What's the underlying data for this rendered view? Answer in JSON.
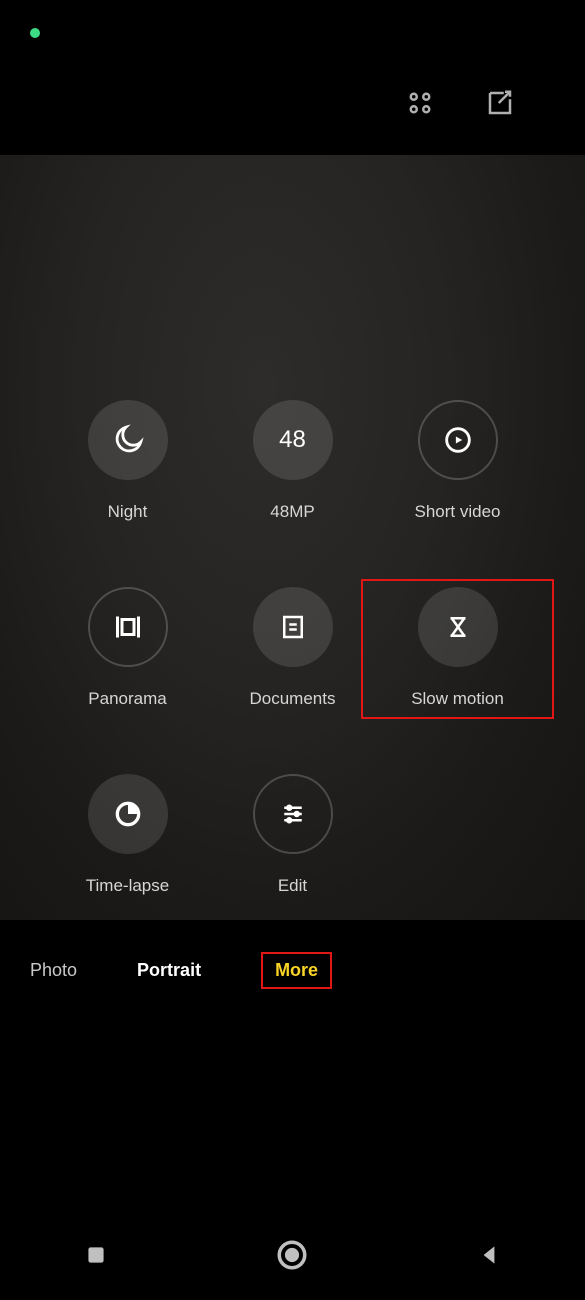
{
  "status": {
    "privacy_indicator": "camera-active"
  },
  "topbar": {
    "grid_icon": "grid-menu",
    "edit_icon": "compose"
  },
  "modes": [
    {
      "id": "night",
      "label": "Night",
      "style": "filled",
      "icon": "moon"
    },
    {
      "id": "48mp",
      "label": "48MP",
      "style": "filled",
      "icon": "text-48",
      "text": "48"
    },
    {
      "id": "short-video",
      "label": "Short video",
      "style": "outlined",
      "icon": "play-circle"
    },
    {
      "id": "panorama",
      "label": "Panorama",
      "style": "outlined",
      "icon": "panorama"
    },
    {
      "id": "documents",
      "label": "Documents",
      "style": "filled",
      "icon": "document"
    },
    {
      "id": "slow-motion",
      "label": "Slow motion",
      "style": "filled",
      "icon": "hourglass",
      "selected": true
    },
    {
      "id": "time-lapse",
      "label": "Time-lapse",
      "style": "filled",
      "icon": "clock-quarter"
    },
    {
      "id": "edit",
      "label": "Edit",
      "style": "outlined",
      "icon": "sliders"
    }
  ],
  "tabs": [
    {
      "id": "photo",
      "label": "Photo",
      "state": "faded"
    },
    {
      "id": "portrait",
      "label": "Portrait",
      "state": "normal"
    },
    {
      "id": "more",
      "label": "More",
      "state": "active"
    }
  ],
  "nav": {
    "recent": "recent",
    "home": "home",
    "back": "back"
  }
}
